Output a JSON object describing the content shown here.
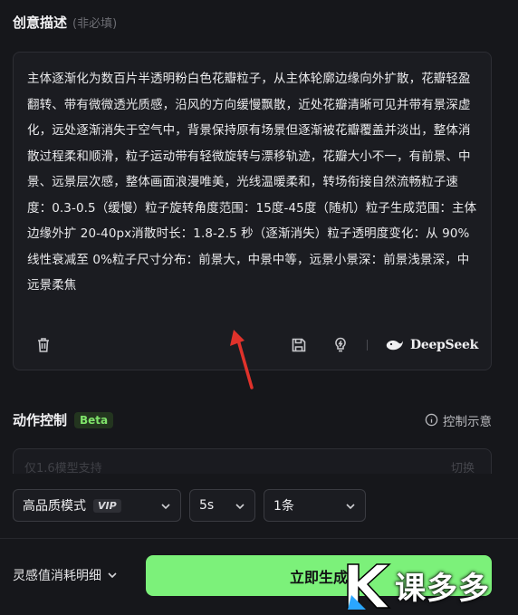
{
  "creative": {
    "title": "创意描述",
    "hint": "(非必填)",
    "description": "主体逐渐化为数百片半透明粉白色花瓣粒子，从主体轮廓边缘向外扩散，花瓣轻盈翻转、带有微微透光质感，沿风的方向缓慢飘散，近处花瓣清晰可见并带有景深虚化，远处逐渐消失于空气中，背景保持原有场景但逐渐被花瓣覆盖并淡出，整体消散过程柔和顺滑，粒子运动带有轻微旋转与漂移轨迹，花瓣大小不一，有前景、中景、远景层次感，整体画面浪漫唯美，光线温暖柔和，转场衔接自然流畅粒子速度：0.3-0.5（缓慢）粒子旋转角度范围：15度-45度（随机）粒子生成范围：主体边缘外扩 20-40px消散时长：1.8-2.5 秒（逐渐消失）粒子透明度变化：从 90% 线性衰减至 0%粒子尺寸分布：前景大，中景中等，远景小景深：前景浅景深，中远景柔焦",
    "deepseek_label": "DeepSeek"
  },
  "action_control": {
    "title": "动作控制",
    "badge": "Beta",
    "hint_link": "控制示意",
    "model_note": "仅1.6模型支持",
    "switch_label": "切换"
  },
  "settings": {
    "quality": "高品质模式",
    "quality_badge": "VIP",
    "duration": "5s",
    "count": "1条"
  },
  "footer": {
    "credits_label": "灵感值消耗明细",
    "generate_label": "立即生成"
  },
  "watermark": {
    "text": "课多多"
  },
  "colors": {
    "accent": "#7cf17a",
    "background": "#16171b",
    "arrow": "#e0322b"
  }
}
